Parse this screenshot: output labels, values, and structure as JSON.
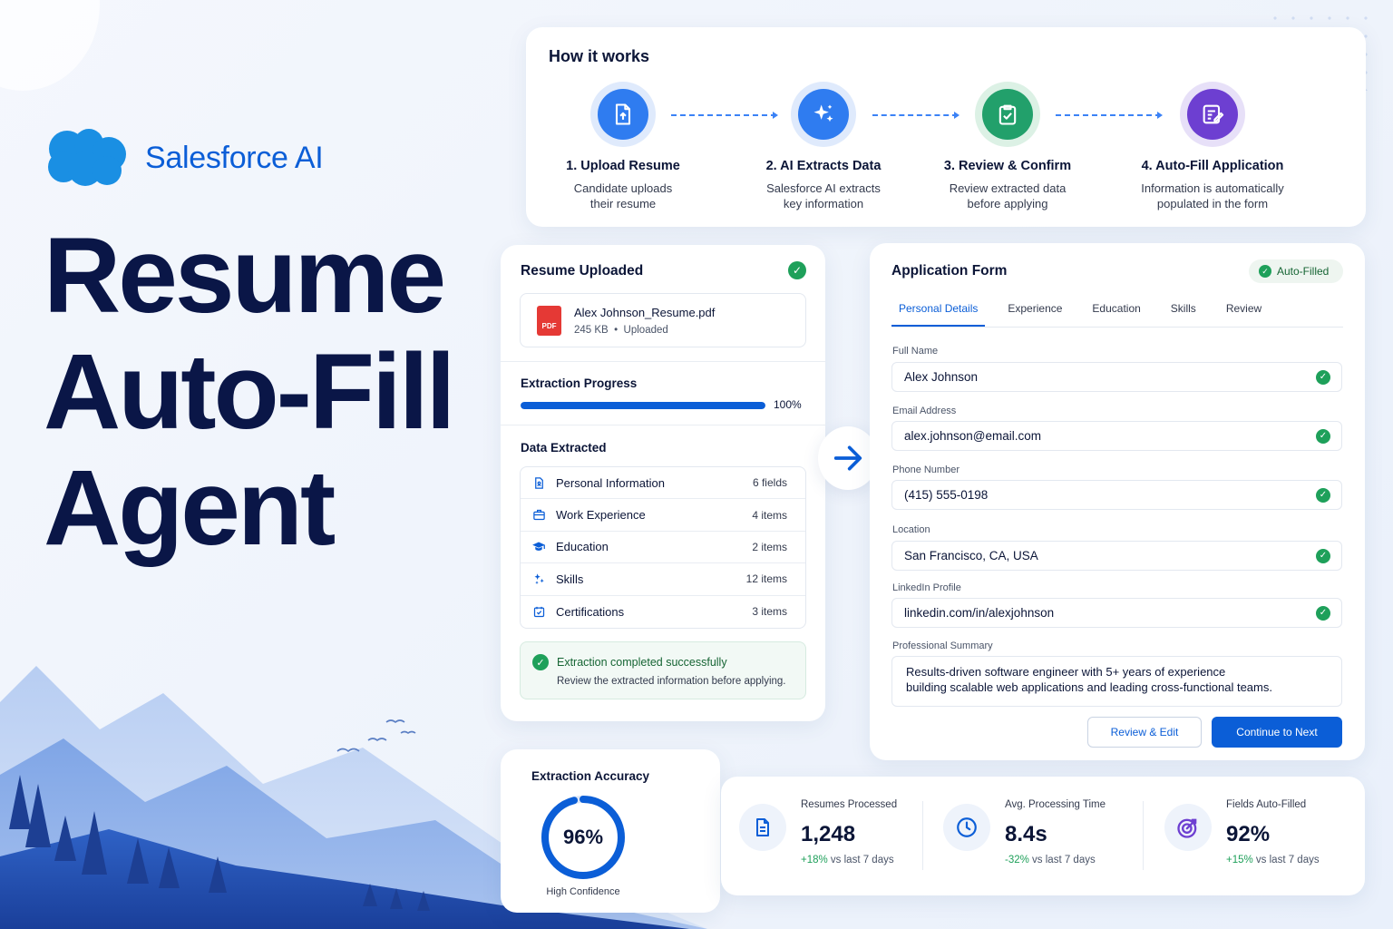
{
  "brand": {
    "name": "Salesforce AI",
    "brand_color": "#0b5ed7"
  },
  "hero": {
    "line1": "Resume",
    "line2": "Auto-Fill",
    "line3": "Agent"
  },
  "how_it_works": {
    "title": "How it works",
    "steps": [
      {
        "title": "1. Upload Resume",
        "desc1": "Candidate uploads",
        "desc2": "their resume",
        "icon": "upload-document-icon"
      },
      {
        "title": "2. AI Extracts Data",
        "desc1": "Salesforce AI extracts",
        "desc2": "key information",
        "icon": "sparkle-icon"
      },
      {
        "title": "3. Review & Confirm",
        "desc1": "Review extracted data",
        "desc2": "before applying",
        "icon": "clipboard-check-icon"
      },
      {
        "title": "4. Auto-Fill Application",
        "desc1": "Information is automatically",
        "desc2": "populated in the form",
        "icon": "form-edit-icon"
      }
    ]
  },
  "resume": {
    "title": "Resume Uploaded",
    "file_name": "Alex Johnson_Resume.pdf",
    "file_size": "245 KB",
    "file_status": "Uploaded",
    "pdf_label": "PDF",
    "progress_label": "Extraction Progress",
    "progress_percent": 100,
    "progress_text": "100%",
    "data_label": "Data Extracted",
    "items": [
      {
        "label": "Personal Information",
        "count": "6 fields",
        "icon": "person-document-icon"
      },
      {
        "label": "Work Experience",
        "count": "4 items",
        "icon": "briefcase-icon"
      },
      {
        "label": "Education",
        "count": "2 items",
        "icon": "graduation-cap-icon"
      },
      {
        "label": "Skills",
        "count": "12 items",
        "icon": "skills-icon"
      },
      {
        "label": "Certifications",
        "count": "3 items",
        "icon": "certificate-icon"
      }
    ],
    "success_title": "Extraction completed successfully",
    "success_desc": "Review the extracted information before applying."
  },
  "form": {
    "title": "Application Form",
    "badge": "Auto-Filled",
    "tabs": [
      "Personal Details",
      "Experience",
      "Education",
      "Skills",
      "Review"
    ],
    "fields": [
      {
        "label": "Full Name",
        "value": "Alex Johnson"
      },
      {
        "label": "Email Address",
        "value": "alex.johnson@email.com"
      },
      {
        "label": "Phone Number",
        "value": "(415) 555-0198"
      },
      {
        "label": "Location",
        "value": "San Francisco, CA, USA"
      },
      {
        "label": "LinkedIn Profile",
        "value": "linkedin.com/in/alexjohnson"
      }
    ],
    "summary_label": "Professional Summary",
    "summary_line1": "Results-driven software engineer with 5+ years of experience",
    "summary_line2": "building scalable web applications and leading cross-functional teams.",
    "review_button": "Review & Edit",
    "continue_button": "Continue to Next"
  },
  "accuracy": {
    "title": "Extraction Accuracy",
    "value": 96,
    "value_text": "96%",
    "confidence": "High Confidence"
  },
  "stats": [
    {
      "label": "Resumes Processed",
      "value": "1,248",
      "change": "+18%",
      "change_suffix": " vs last 7 days",
      "icon": "document-icon"
    },
    {
      "label": "Avg. Processing Time",
      "value": "8.4s",
      "change": "-32%",
      "change_suffix": " vs last 7 days",
      "icon": "clock-icon"
    },
    {
      "label": "Fields Auto-Filled",
      "value": "92%",
      "change": "+15%",
      "change_suffix": " vs last 7 days",
      "icon": "target-icon"
    }
  ],
  "colors": {
    "primary": "#0b5ed7",
    "success": "#1ea05a",
    "purple": "#6d3fd1",
    "green_step": "#22a06b"
  }
}
